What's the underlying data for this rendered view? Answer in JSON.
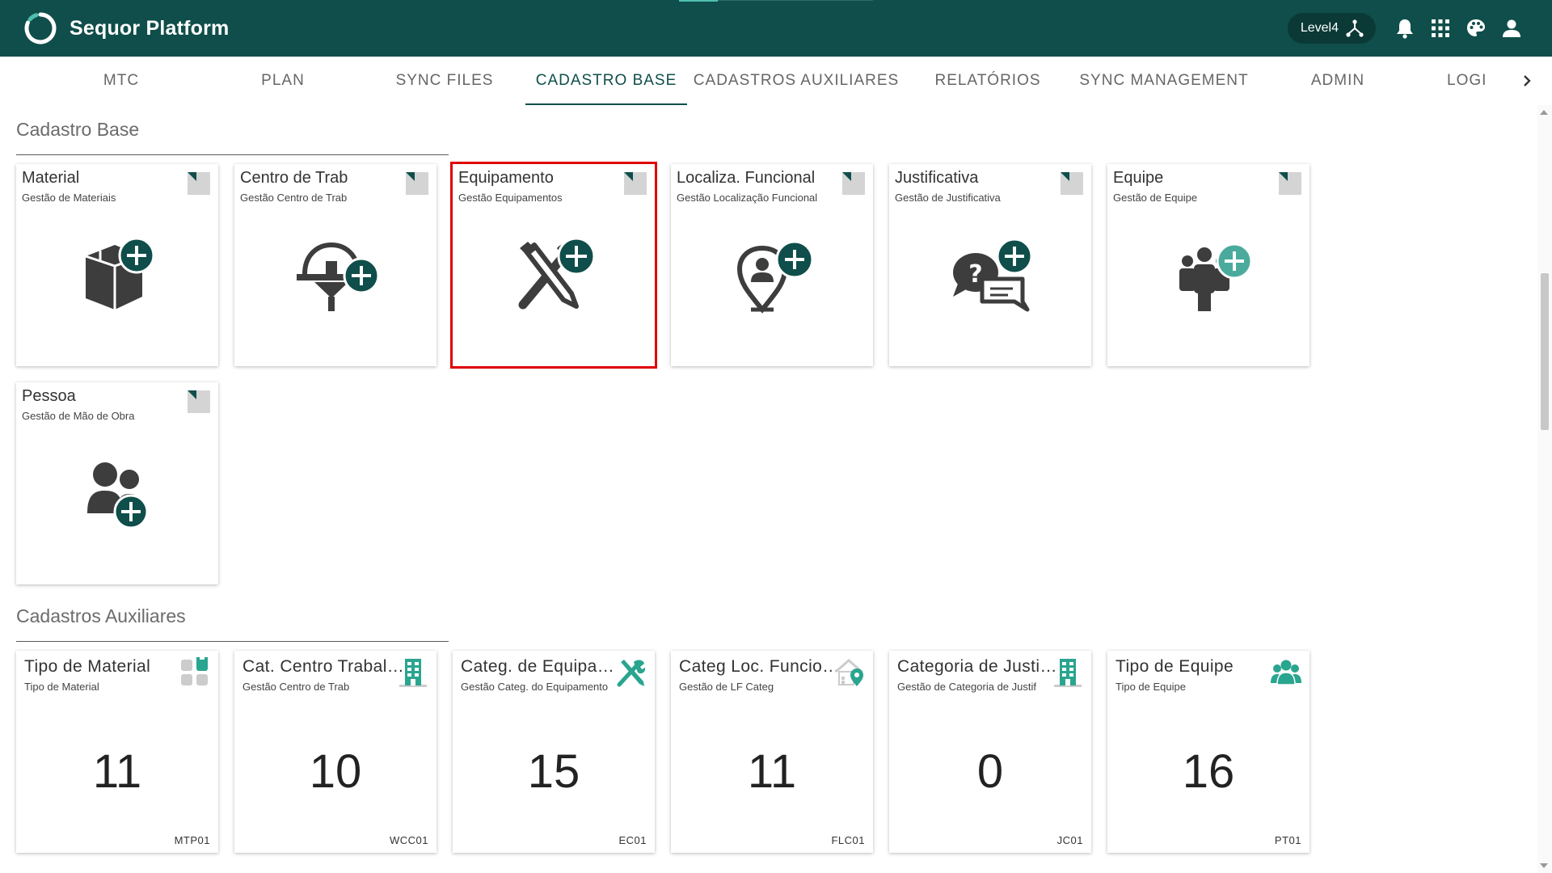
{
  "app": {
    "title": "Sequor Platform"
  },
  "header": {
    "level_label": "Level4"
  },
  "tabs": [
    {
      "label": "MTC"
    },
    {
      "label": "PLAN"
    },
    {
      "label": "SYNC FILES"
    },
    {
      "label": "CADASTRO BASE",
      "active": true
    },
    {
      "label": "CADASTROS AUXILIARES"
    },
    {
      "label": "RELATÓRIOS"
    },
    {
      "label": "SYNC MANAGEMENT"
    },
    {
      "label": "ADMIN"
    },
    {
      "label": "LOGI"
    }
  ],
  "sections": {
    "base": {
      "title": "Cadastro Base",
      "cards": [
        {
          "title": "Material",
          "subtitle": "Gestão de Materiais",
          "icon": "box-plus-icon"
        },
        {
          "title": "Centro de Trab",
          "subtitle": "Gestão Centro de Trab",
          "icon": "hardhat-plus-icon"
        },
        {
          "title": "Equipamento",
          "subtitle": "Gestão Equipamentos",
          "icon": "tools-plus-icon",
          "selected": true
        },
        {
          "title": "Localiza. Funcional",
          "subtitle": "Gestão Localização Funcional",
          "icon": "location-person-plus-icon"
        },
        {
          "title": "Justificativa",
          "subtitle": "Gestão de Justificativa",
          "icon": "chat-question-plus-icon"
        },
        {
          "title": "Equipe",
          "subtitle": "Gestão de Equipe",
          "icon": "team-plus-icon"
        },
        {
          "title": "Pessoa",
          "subtitle": "Gestão de Mão de Obra",
          "icon": "people-plus-icon"
        }
      ]
    },
    "aux": {
      "title": "Cadastros Auxiliares",
      "cards": [
        {
          "title": "Tipo de Material",
          "subtitle": "Tipo de Material",
          "count": "11",
          "code": "MTP01",
          "icon": "grid-blocks-icon"
        },
        {
          "title": "Cat. Centro Trabalho",
          "subtitle": "Gestão Centro de Trab",
          "count": "10",
          "code": "WCC01",
          "icon": "building-icon"
        },
        {
          "title": "Categ. de Equipamento",
          "subtitle": "Gestão Categ. do Equipamento",
          "count": "15",
          "code": "EC01",
          "icon": "tools-icon"
        },
        {
          "title": "Categ Loc. Funcional",
          "subtitle": "Gestão de LF Categ",
          "count": "11",
          "code": "FLC01",
          "icon": "home-pin-icon"
        },
        {
          "title": "Categoria de Justificativa",
          "subtitle": "Gestão de Categoria de Justif",
          "count": "0",
          "code": "JC01",
          "icon": "building-icon"
        },
        {
          "title": "Tipo de Equipe",
          "subtitle": "Tipo de Equipe",
          "count": "16",
          "code": "PT01",
          "icon": "group-icon"
        }
      ]
    }
  },
  "colors": {
    "primary": "#0f4e4a",
    "accent": "#2aa58f",
    "icon_dark": "#3d3d3d",
    "highlight": "#e00000"
  }
}
